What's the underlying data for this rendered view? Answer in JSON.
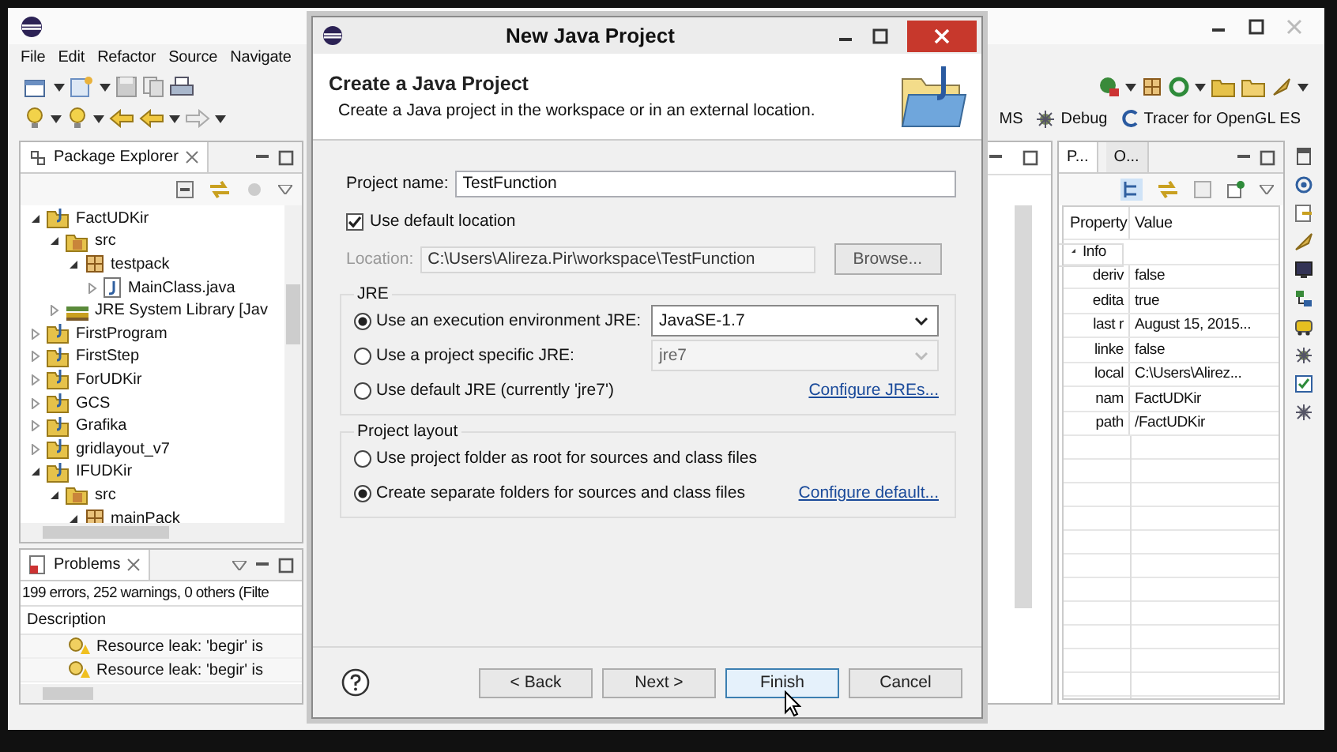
{
  "menu": [
    "File",
    "Edit",
    "Refactor",
    "Source",
    "Navigate"
  ],
  "perspectives": [
    "MS",
    "Debug",
    "Tracer for OpenGL ES"
  ],
  "package_explorer": {
    "title": "Package Explorer",
    "tree": [
      {
        "label": "FactUDKir",
        "kind": "project",
        "expanded": true,
        "children": [
          {
            "label": "src",
            "kind": "source",
            "expanded": true,
            "children": [
              {
                "label": "testpack",
                "kind": "package",
                "expanded": true,
                "children": [
                  {
                    "label": "MainClass.java",
                    "kind": "java",
                    "expanded": false
                  }
                ]
              }
            ]
          },
          {
            "label": "JRE System Library [Jav",
            "kind": "library",
            "expanded": false
          }
        ]
      },
      {
        "label": "FirstProgram",
        "kind": "project",
        "expanded": false
      },
      {
        "label": "FirstStep",
        "kind": "project",
        "expanded": false
      },
      {
        "label": "ForUDKir",
        "kind": "project",
        "expanded": false
      },
      {
        "label": "GCS",
        "kind": "project",
        "expanded": false
      },
      {
        "label": "Grafika",
        "kind": "project",
        "expanded": false
      },
      {
        "label": "gridlayout_v7",
        "kind": "project",
        "expanded": false
      },
      {
        "label": "IFUDKir",
        "kind": "project",
        "expanded": true,
        "children": [
          {
            "label": "src",
            "kind": "source",
            "expanded": true,
            "children": [
              {
                "label": "mainPack",
                "kind": "package",
                "expanded": true
              }
            ]
          }
        ]
      }
    ]
  },
  "problems": {
    "title": "Problems",
    "summary": "199 errors, 252 warnings, 0 others (Filte",
    "column": "Description",
    "rows": [
      "Resource leak: 'begir' is",
      "Resource leak: 'begir' is"
    ]
  },
  "properties": {
    "tabs": [
      {
        "label": "P...",
        "selected": true
      },
      {
        "label": "O...",
        "selected": false
      }
    ],
    "columns": [
      "Property",
      "Value"
    ],
    "group": "Info",
    "rows": [
      {
        "property": "deriv",
        "value": "false"
      },
      {
        "property": "edita",
        "value": "true"
      },
      {
        "property": "last r",
        "value": "August 15, 2015..."
      },
      {
        "property": "linke",
        "value": "false"
      },
      {
        "property": "local",
        "value": "C:\\Users\\Alirez..."
      },
      {
        "property": "nam",
        "value": "FactUDKir"
      },
      {
        "property": "path",
        "value": "/FactUDKir"
      }
    ]
  },
  "dialog": {
    "title": "New Java Project",
    "heading": "Create a Java Project",
    "description": "Create a Java project in the workspace or in an external location.",
    "project_name": {
      "label": "Project name:",
      "value": "TestFunction"
    },
    "default_location": {
      "label": "Use default location",
      "checked": true
    },
    "location": {
      "label": "Location:",
      "value": "C:\\Users\\Alireza.Pir\\workspace\\TestFunction",
      "disabled": true
    },
    "browse": "Browse...",
    "jre": {
      "title": "JRE",
      "options": [
        {
          "label": "Use an execution environment JRE:",
          "selected": true,
          "dropdown": {
            "value": "JavaSE-1.7",
            "disabled": false
          }
        },
        {
          "label": "Use a project specific JRE:",
          "selected": false,
          "dropdown": {
            "value": "jre7",
            "disabled": true
          }
        },
        {
          "label": "Use default JRE (currently 'jre7')",
          "selected": false,
          "link": "Configure JREs..."
        }
      ]
    },
    "layout": {
      "title": "Project layout",
      "options": [
        {
          "label": "Use project folder as root for sources and class files",
          "selected": false
        },
        {
          "label": "Create separate folders for sources and class files",
          "selected": true,
          "link": "Configure default..."
        }
      ]
    },
    "buttons": [
      {
        "label": "< Back",
        "focused": false
      },
      {
        "label": "Next >",
        "focused": false
      },
      {
        "label": "Finish",
        "focused": true
      },
      {
        "label": "Cancel",
        "focused": false
      }
    ]
  }
}
